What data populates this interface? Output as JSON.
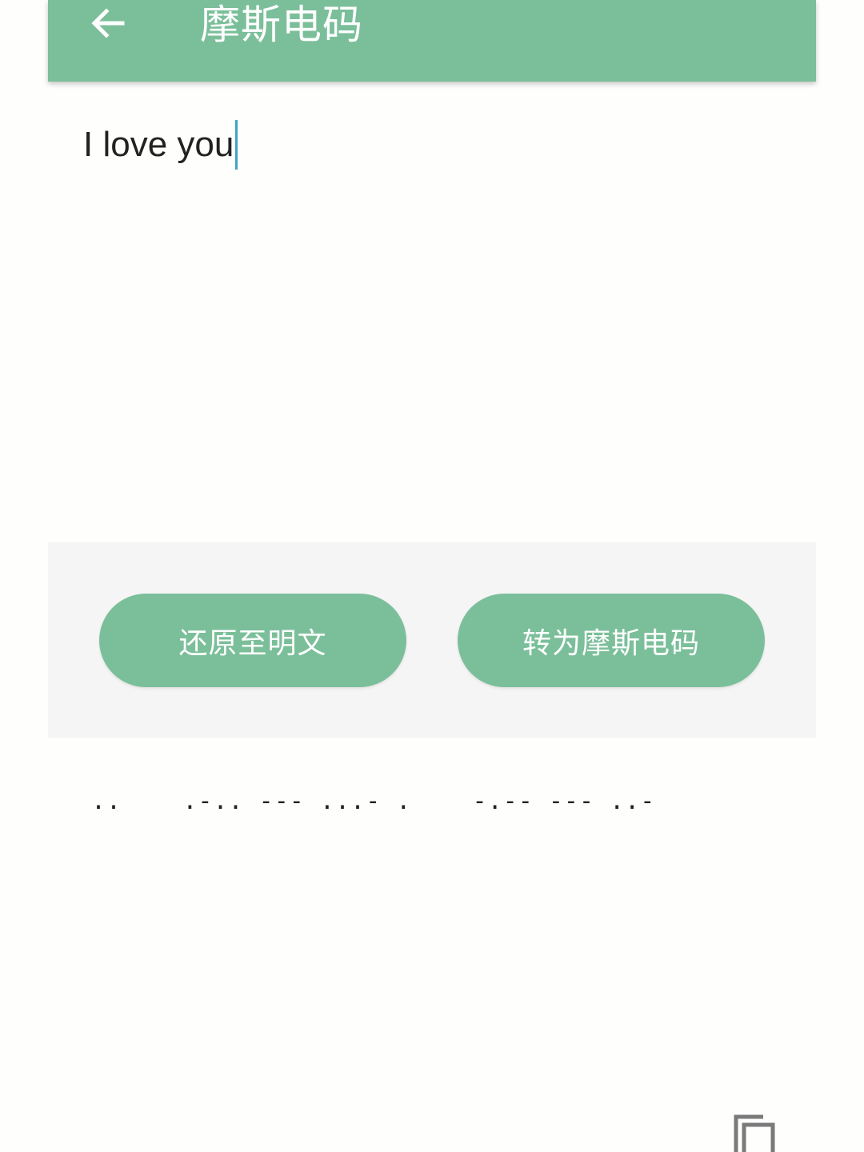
{
  "toolbar": {
    "title": "摩斯电码",
    "back_icon": "arrow-left-icon",
    "background_color": "#7bbf9a"
  },
  "input": {
    "value": "I love you"
  },
  "actions": {
    "restore_label": "还原至明文",
    "convert_label": "转为摩斯电码"
  },
  "output": {
    "value": "..    .-.. --- ...- .    -.-- --- ..-",
    "copy_icon": "copy-icon"
  },
  "colors": {
    "accent": "#7bbf9a",
    "panel": "#f5f5f5",
    "caret": "#3aa7c4"
  }
}
